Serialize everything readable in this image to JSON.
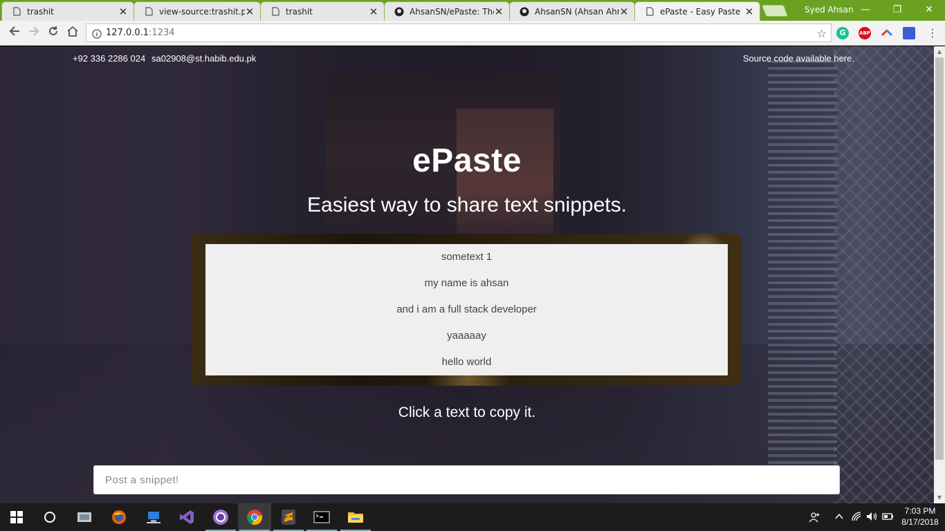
{
  "browser": {
    "tabs": [
      {
        "title": "trashit",
        "icon": "page-icon",
        "active": false
      },
      {
        "title": "view-source:trashit.pk/",
        "icon": "page-icon",
        "active": false
      },
      {
        "title": "trashit",
        "icon": "page-icon",
        "active": false
      },
      {
        "title": "AhsanSN/ePaste: The e",
        "icon": "github-icon",
        "active": false
      },
      {
        "title": "AhsanSN (Ahsan Ahme",
        "icon": "github-icon",
        "active": false
      },
      {
        "title": "ePaste - Easy Paste",
        "icon": "page-icon",
        "active": true
      }
    ],
    "close_glyph": "✕",
    "profile_name": "Syed Ahsan",
    "window_controls": {
      "minimize": "—",
      "restore": "❐",
      "close": "✕"
    },
    "url_host": "127.0.0.1",
    "url_port": ":1234",
    "extensions": [
      {
        "name": "grammarly-icon",
        "label": "G",
        "color": "#15c39a"
      },
      {
        "name": "adblock-icon",
        "label": "ABP",
        "color": "#d8101a"
      },
      {
        "name": "color-ext-icon",
        "label": "",
        "color": "#f4b400"
      },
      {
        "name": "ext-icon",
        "label": "",
        "color": "#3b5cd8"
      }
    ],
    "accent_color": "#6aa121"
  },
  "page": {
    "phone": "+92 336 2286 024",
    "email": "sa02908@st.habib.edu.pk",
    "source_link": "Source code available here.",
    "brand": "ePaste",
    "tagline": "Easiest way to share text snippets.",
    "snippets": [
      "sometext 1",
      "my name is ahsan",
      "and i am a full stack developer",
      "yaaaaay",
      "hello world"
    ],
    "hint": "Click a text to copy it.",
    "post_placeholder": "Post a snippet!"
  },
  "taskbar": {
    "apps": [
      {
        "name": "cortana-icon"
      },
      {
        "name": "task-view-icon"
      },
      {
        "name": "firefox-icon"
      },
      {
        "name": "remote-desktop-icon"
      },
      {
        "name": "visual-studio-icon"
      },
      {
        "name": "github-desktop-icon"
      },
      {
        "name": "chrome-icon"
      },
      {
        "name": "sublime-icon"
      },
      {
        "name": "terminal-icon"
      },
      {
        "name": "file-explorer-icon"
      }
    ],
    "time": "7:03 PM",
    "date": "8/17/2018"
  }
}
